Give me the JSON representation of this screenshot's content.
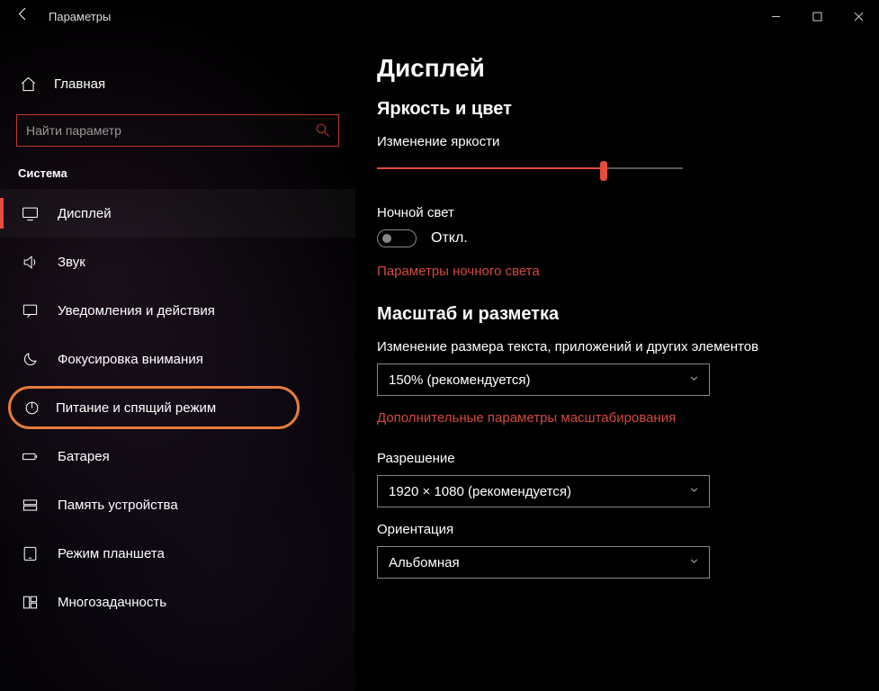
{
  "titlebar": {
    "title": "Параметры"
  },
  "home_label": "Главная",
  "search": {
    "placeholder": "Найти параметр"
  },
  "section_label": "Система",
  "nav": [
    {
      "label": "Дисплей",
      "name": "sidebar-item-display",
      "icon": "monitor-icon",
      "selected": true
    },
    {
      "label": "Звук",
      "name": "sidebar-item-sound",
      "icon": "speaker-icon"
    },
    {
      "label": "Уведомления и действия",
      "name": "sidebar-item-notifications",
      "icon": "message-icon"
    },
    {
      "label": "Фокусировка внимания",
      "name": "sidebar-item-focus-assist",
      "icon": "moon-icon"
    },
    {
      "label": "Питание и спящий режим",
      "name": "sidebar-item-power-sleep",
      "icon": "power-icon",
      "highlight": true
    },
    {
      "label": "Батарея",
      "name": "sidebar-item-battery",
      "icon": "battery-icon"
    },
    {
      "label": "Память устройства",
      "name": "sidebar-item-storage",
      "icon": "storage-icon"
    },
    {
      "label": "Режим планшета",
      "name": "sidebar-item-tablet-mode",
      "icon": "tablet-icon"
    },
    {
      "label": "Многозадачность",
      "name": "sidebar-item-multitasking",
      "icon": "timeline-icon"
    }
  ],
  "page": {
    "heading": "Дисплей",
    "section_brightness": "Яркость и цвет",
    "brightness_label": "Изменение яркости",
    "brightness_percent": 74,
    "nightlight_label": "Ночной свет",
    "nightlight_state": "Откл.",
    "nightlight_link": "Параметры ночного света",
    "section_scale": "Масштаб и разметка",
    "scale_label": "Изменение размера текста, приложений и других элементов",
    "scale_value": "150% (рекомендуется)",
    "scale_link": "Дополнительные параметры масштабирования",
    "resolution_label": "Разрешение",
    "resolution_value": "1920 × 1080 (рекомендуется)",
    "orientation_label": "Ориентация",
    "orientation_value": "Альбомная"
  }
}
